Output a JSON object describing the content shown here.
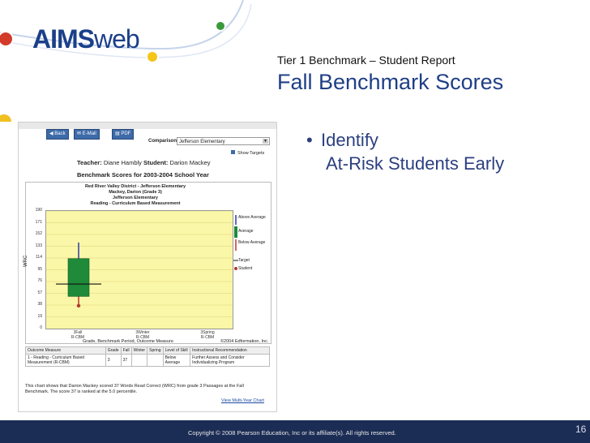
{
  "logo": {
    "brand_bold": "AIMS",
    "brand_light": "web"
  },
  "slide": {
    "subtitle": "Tier 1 Benchmark – Student Report",
    "title": "Fall Benchmark Scores",
    "bullet_line1": "Identify",
    "bullet_line2": "At-Risk Students Early",
    "copyright": "Copyright © 2008 Pearson Education, Inc or its affiliate(s). All rights reserved.",
    "page_number": "16"
  },
  "toolbar": {
    "back_label": "Back",
    "email_label": "E-Mail",
    "pdf_label": "PDF"
  },
  "comparison": {
    "label": "Comparison:",
    "selected": "Jefferson Elementary"
  },
  "show_targets": {
    "label": "Show Targets",
    "checked": true
  },
  "report": {
    "teacher_label": "Teacher:",
    "teacher_name": "Diane Hambly",
    "student_label": "Student:",
    "student_name": "Darion Mackey",
    "benchmark_title": "Benchmark Scores for 2003-2004 School Year"
  },
  "chart_data": {
    "type": "box",
    "header_lines": [
      "Red River Valley District - Jefferson Elementary",
      "Mackey, Darion (Grade 3)",
      "Jefferson Elementary",
      "Reading - Curriculum Based Measurement"
    ],
    "ylabel": "WRC",
    "xlabel": "Grade, Benchmark Period, Outcome Measure",
    "credit": "©2004 Edformation, Inc.",
    "ylim": [
      0,
      190
    ],
    "yticks": [
      0,
      19,
      38,
      57,
      76,
      95,
      114,
      133,
      152,
      171,
      190
    ],
    "categories": [
      {
        "line1": "3Fall",
        "line2": "R-CBM"
      },
      {
        "line1": "3Winter",
        "line2": "R-CBM"
      },
      {
        "line1": "3Spring",
        "line2": "R-CBM"
      }
    ],
    "box": {
      "category_index": 0,
      "whisker_low": 36,
      "q1": 52,
      "median": 78,
      "q3": 113,
      "whisker_high": 139,
      "target": 72
    },
    "student": {
      "category_index": 0,
      "value": 37
    },
    "legend": [
      {
        "label": "Above Average"
      },
      {
        "label": "Average"
      },
      {
        "label": "Below Average"
      },
      {
        "label": "Target"
      },
      {
        "label": "Student"
      }
    ],
    "colors": {
      "plot_bg": "#fbf7a8",
      "box": "#1e8a3a",
      "whisker_high": "#2b3aa8",
      "whisker_low": "#c0392b",
      "target": "#111111",
      "student": "#b03a2e"
    }
  },
  "table": {
    "headers": [
      "Outcome Measure",
      "Grade",
      "Fall",
      "Winter",
      "Spring",
      "Level of Skill",
      "Instructional Recommendation"
    ],
    "row": [
      "1 - Reading - Curriculum Based Measurement (R-CBM)",
      "3",
      "37",
      "",
      "",
      "Below Average",
      "Further Assess and Consider Individualizing Program"
    ]
  },
  "note": "This chart shows that Darion Mackey scored 37 Words Read Correct (WRC) from grade 3 Passages at the Fall Benchmark. The score 37 is ranked at the 5.0 percentile.",
  "view_link": "View Multi-Year Chart"
}
